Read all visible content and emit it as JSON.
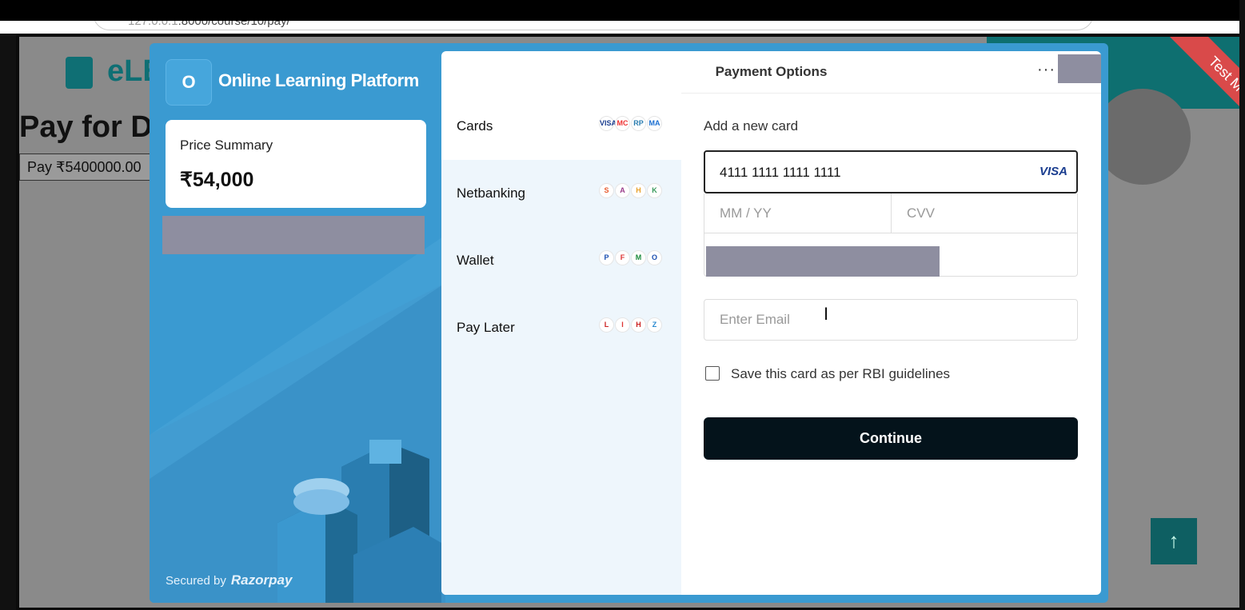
{
  "browser": {
    "url_dim": "127.0.0.1",
    "url_rest": ":8000/course/10/pay/"
  },
  "page": {
    "logo_text": "eLE",
    "pay_title": "Pay for D",
    "pay_button": "Pay ₹5400000.00",
    "test_mode": "Test Mode",
    "scroll_top_icon": "↑"
  },
  "checkout": {
    "merchant_initial": "O",
    "merchant_name": "Online Learning Platform",
    "price_label": "Price Summary",
    "price_value": "₹54,000",
    "secured_by": "Secured by",
    "brand": "Razorpay",
    "panel_title": "Payment Options",
    "more_icon": "···",
    "methods": [
      {
        "label": "Cards",
        "icons": [
          "VISA",
          "MC",
          "RP",
          "MA"
        ]
      },
      {
        "label": "Netbanking",
        "icons": [
          "S",
          "A",
          "H",
          "K"
        ]
      },
      {
        "label": "Wallet",
        "icons": [
          "P",
          "F",
          "M",
          "O"
        ]
      },
      {
        "label": "Pay Later",
        "icons": [
          "L",
          "I",
          "H",
          "Z"
        ]
      }
    ],
    "add_card": "Add a new card",
    "card_number": "4111 1111 1111 1111",
    "card_brand": "VISA",
    "expiry_placeholder": "MM / YY",
    "cvv_placeholder": "CVV",
    "email_placeholder": "Enter Email",
    "save_card_label": "Save this card as per RBI guidelines",
    "continue_label": "Continue"
  },
  "colors": {
    "modal_blue": "#3a9ad1",
    "teal": "#0e6f70",
    "continue_bg": "#04131b",
    "ribbon_red": "#d94a4a"
  }
}
